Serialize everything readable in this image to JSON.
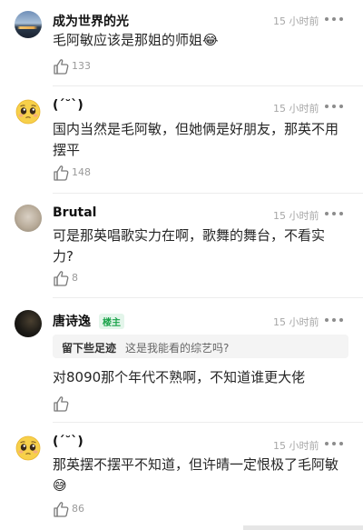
{
  "comments": [
    {
      "username": "成为世界的光",
      "time": "15 小时前",
      "avatar": "landscape-photo-avatar",
      "text": "毛阿敏应该是那姐的师姐😂",
      "likes": "133"
    },
    {
      "username": "(ˊ˘ˋ)",
      "time": "15 小时前",
      "avatar": "pleading-face-emoji-avatar",
      "text": "国内当然是毛阿敏，但她俩是好朋友，那英不用摆平",
      "likes": "148"
    },
    {
      "username": "Brutal",
      "time": "15 小时前",
      "avatar": "person-photo-avatar",
      "text": "可是那英唱歌实力在啊，歌舞的舞台，不看实力?",
      "likes": "8"
    },
    {
      "username": "唐诗逸",
      "badge": "楼主",
      "time": "15 小时前",
      "avatar": "dark-photo-avatar",
      "reply_to_user": "留下些足迹",
      "reply_to_text": "这是我能看的综艺吗?",
      "text": "对8090那个年代不熟啊，不知道谁更大佬",
      "likes": ""
    },
    {
      "username": "(ˊ˘ˋ)",
      "time": "15 小时前",
      "avatar": "pleading-face-emoji-avatar",
      "text": "那英摆不摆平不知道，但许晴一定恨极了毛阿敏😅",
      "likes": "86"
    }
  ],
  "icons": {
    "like": "thumbs-up-icon",
    "more": "more-dots-icon"
  },
  "colors": {
    "host_badge": "#1aa34a",
    "time": "#a7a7a7",
    "reply_bg": "#f4f4f4"
  }
}
